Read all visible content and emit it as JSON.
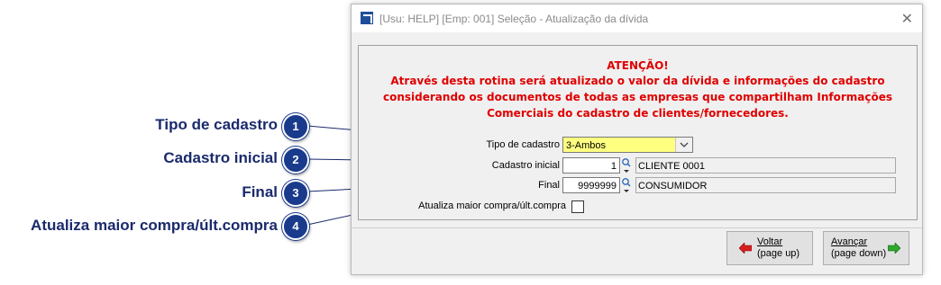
{
  "callouts": [
    {
      "number": "1",
      "label": "Tipo de cadastro"
    },
    {
      "number": "2",
      "label": "Cadastro inicial"
    },
    {
      "number": "3",
      "label": "Final"
    },
    {
      "number": "4",
      "label": "Atualiza maior compra/últ.compra"
    }
  ],
  "window": {
    "title": "[Usu: HELP] [Emp: 001] Seleção - Atualização da dívida",
    "close_glyph": "✕"
  },
  "warning": {
    "heading": "ATENÇÃO!",
    "line1": "Através desta rotina será atualizado o valor da dívida e informações do cadastro",
    "line2": "considerando os documentos de todas as empresas que compartilham Informações",
    "line3": "Comerciais do cadastro de clientes/fornecedores."
  },
  "form": {
    "tipo_label": "Tipo de cadastro",
    "tipo_value": "3-Ambos",
    "inicial_label": "Cadastro inicial",
    "inicial_code": "1",
    "inicial_name": "CLIENTE 0001",
    "final_label": "Final",
    "final_code": "9999999",
    "final_name": "CONSUMIDOR",
    "atualiza_label": "Atualiza maior compra/últ.compra",
    "atualiza_checked": false
  },
  "buttons": {
    "voltar_line1": "Voltar",
    "voltar_line2": "(page up)",
    "avancar_line1": "Avançar",
    "avancar_line2": "(page down)"
  },
  "colors": {
    "callout_blue": "#1a3a8c",
    "warning_red": "#e00000",
    "combo_yellow": "#ffff80"
  }
}
